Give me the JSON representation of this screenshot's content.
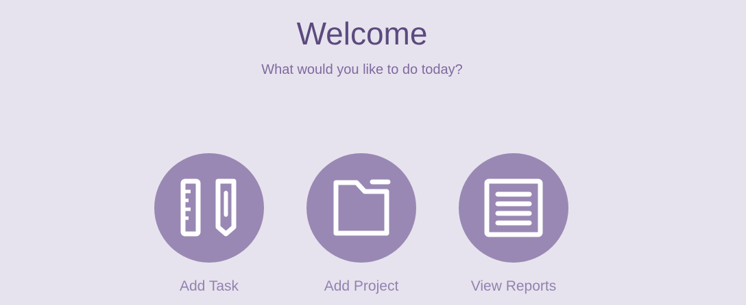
{
  "header": {
    "title": "Welcome",
    "subtitle": "What would you like to do today?"
  },
  "actions": [
    {
      "label": "Add Task",
      "icon": "ruler-pencil-icon"
    },
    {
      "label": "Add Project",
      "icon": "folder-icon"
    },
    {
      "label": "View Reports",
      "icon": "document-lines-icon"
    }
  ],
  "colors": {
    "background": "#e7e3ee",
    "title": "#5b4a7e",
    "subtitle": "#7e6a9f",
    "circle": "#9988b4",
    "icon": "#ffffff",
    "label": "#9282b0"
  }
}
